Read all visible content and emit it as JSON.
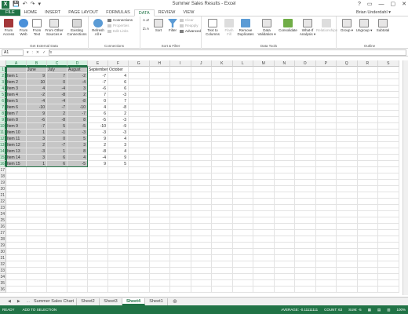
{
  "window": {
    "title": "Summer Sales Results - Excel",
    "logo": "X",
    "qat": [
      "💾",
      "↶",
      "↷",
      "▾"
    ],
    "controls": [
      "?",
      "▭",
      "—",
      "▢",
      "✕"
    ]
  },
  "ribbon_tabs": [
    "FILE",
    "HOME",
    "INSERT",
    "PAGE LAYOUT",
    "FORMULAS",
    "DATA",
    "REVIEW",
    "VIEW"
  ],
  "active_tab": "DATA",
  "user": "Brian Underdahl ▾",
  "groups": {
    "external": {
      "label": "Get External Data",
      "buttons": [
        "From Access",
        "From Web",
        "From Text",
        "From Other Sources ▾",
        "Existing Connections"
      ]
    },
    "connections": {
      "label": "Connections",
      "refresh": "Refresh All ▾",
      "small": [
        "Connections",
        "Properties",
        "Edit Links"
      ]
    },
    "sortfilter": {
      "label": "Sort & Filter",
      "az": "A↓Z",
      "za": "Z↓A",
      "sort": "Sort",
      "filter": "Filter",
      "small": [
        "Clear",
        "Reapply",
        "Advanced"
      ]
    },
    "datatools": {
      "label": "Data Tools",
      "buttons": [
        "Text to Columns",
        "Flash Fill",
        "Remove Duplicates",
        "Data Validation ▾",
        "Consolidate",
        "What-If Analysis ▾",
        "Relationships"
      ]
    },
    "outline": {
      "label": "Outline",
      "buttons": [
        "Group ▾",
        "Ungroup ▾",
        "Subtotal"
      ]
    }
  },
  "formula_bar": {
    "name_box": "A1",
    "icons": [
      "▾",
      ":",
      "✕",
      "✓",
      "fx"
    ],
    "value": ""
  },
  "columns": [
    "A",
    "B",
    "C",
    "D",
    "E",
    "F",
    "G",
    "H",
    "I",
    "J",
    "K",
    "L",
    "M",
    "N",
    "O",
    "P",
    "Q",
    "R",
    "S"
  ],
  "headers": {
    "B": "June",
    "C": "July",
    "D": "August",
    "E": "September",
    "F": "October"
  },
  "rows": [
    {
      "label": "Item 1",
      "B": "9",
      "C": "7",
      "D": "-2",
      "E": "-7",
      "F": "4"
    },
    {
      "label": "Item 2",
      "B": "10",
      "C": "0",
      "D": "-4",
      "E": "-7",
      "F": "6"
    },
    {
      "label": "Item 3",
      "B": "4",
      "C": "-4",
      "D": "3",
      "E": "-6",
      "F": "6"
    },
    {
      "label": "Item 4",
      "B": "-2",
      "C": "-8",
      "D": "2",
      "E": "7",
      "F": "-3"
    },
    {
      "label": "Item 5",
      "B": "-4",
      "C": "-4",
      "D": "-8",
      "E": "0",
      "F": "7"
    },
    {
      "label": "Item 6",
      "B": "-10",
      "C": "-7",
      "D": "-10",
      "E": "4",
      "F": "-8"
    },
    {
      "label": "Item 7",
      "B": "9",
      "C": "2",
      "D": "-7",
      "E": "6",
      "F": "2"
    },
    {
      "label": "Item 8",
      "B": "-6",
      "C": "-8",
      "D": "8",
      "E": "-5",
      "F": "-3"
    },
    {
      "label": "Item 9",
      "B": "-7",
      "C": "5",
      "D": "-5",
      "E": "-10",
      "F": "-9"
    },
    {
      "label": "Item 10",
      "B": "1",
      "C": "-1",
      "D": "-3",
      "E": "-3",
      "F": "-3"
    },
    {
      "label": "Item 11",
      "B": "3",
      "C": "0",
      "D": "5",
      "E": "9",
      "F": "4"
    },
    {
      "label": "Item 12",
      "B": "2",
      "C": "-7",
      "D": "3",
      "E": "2",
      "F": "3"
    },
    {
      "label": "Item 13",
      "B": "-3",
      "C": "1",
      "D": "8",
      "E": "-8",
      "F": "4"
    },
    {
      "label": "Item 14",
      "B": "3",
      "C": "6",
      "D": "4",
      "E": "-4",
      "F": "9"
    },
    {
      "label": "Item 15",
      "B": "1",
      "C": "6",
      "D": "-5",
      "E": "9",
      "F": "5"
    }
  ],
  "sheets": [
    "Summer Sales Chart",
    "Sheet2",
    "Sheet3",
    "Sheet4",
    "Sheet1"
  ],
  "active_sheet": "Sheet4",
  "sheet_nav": [
    "◀",
    "▶",
    "..."
  ],
  "add_sheet": "⊕",
  "status": {
    "ready": "READY",
    "add": "ADD TO SELECTION",
    "average": "AVERAGE: -0.11111111",
    "count": "COUNT: 63",
    "sum": "SUM: -5",
    "view_icons": [
      "▦",
      "▤",
      "▥"
    ],
    "zoom": "100%"
  },
  "colors": {
    "accent": "#217346",
    "selection": "#c6c6c6"
  }
}
